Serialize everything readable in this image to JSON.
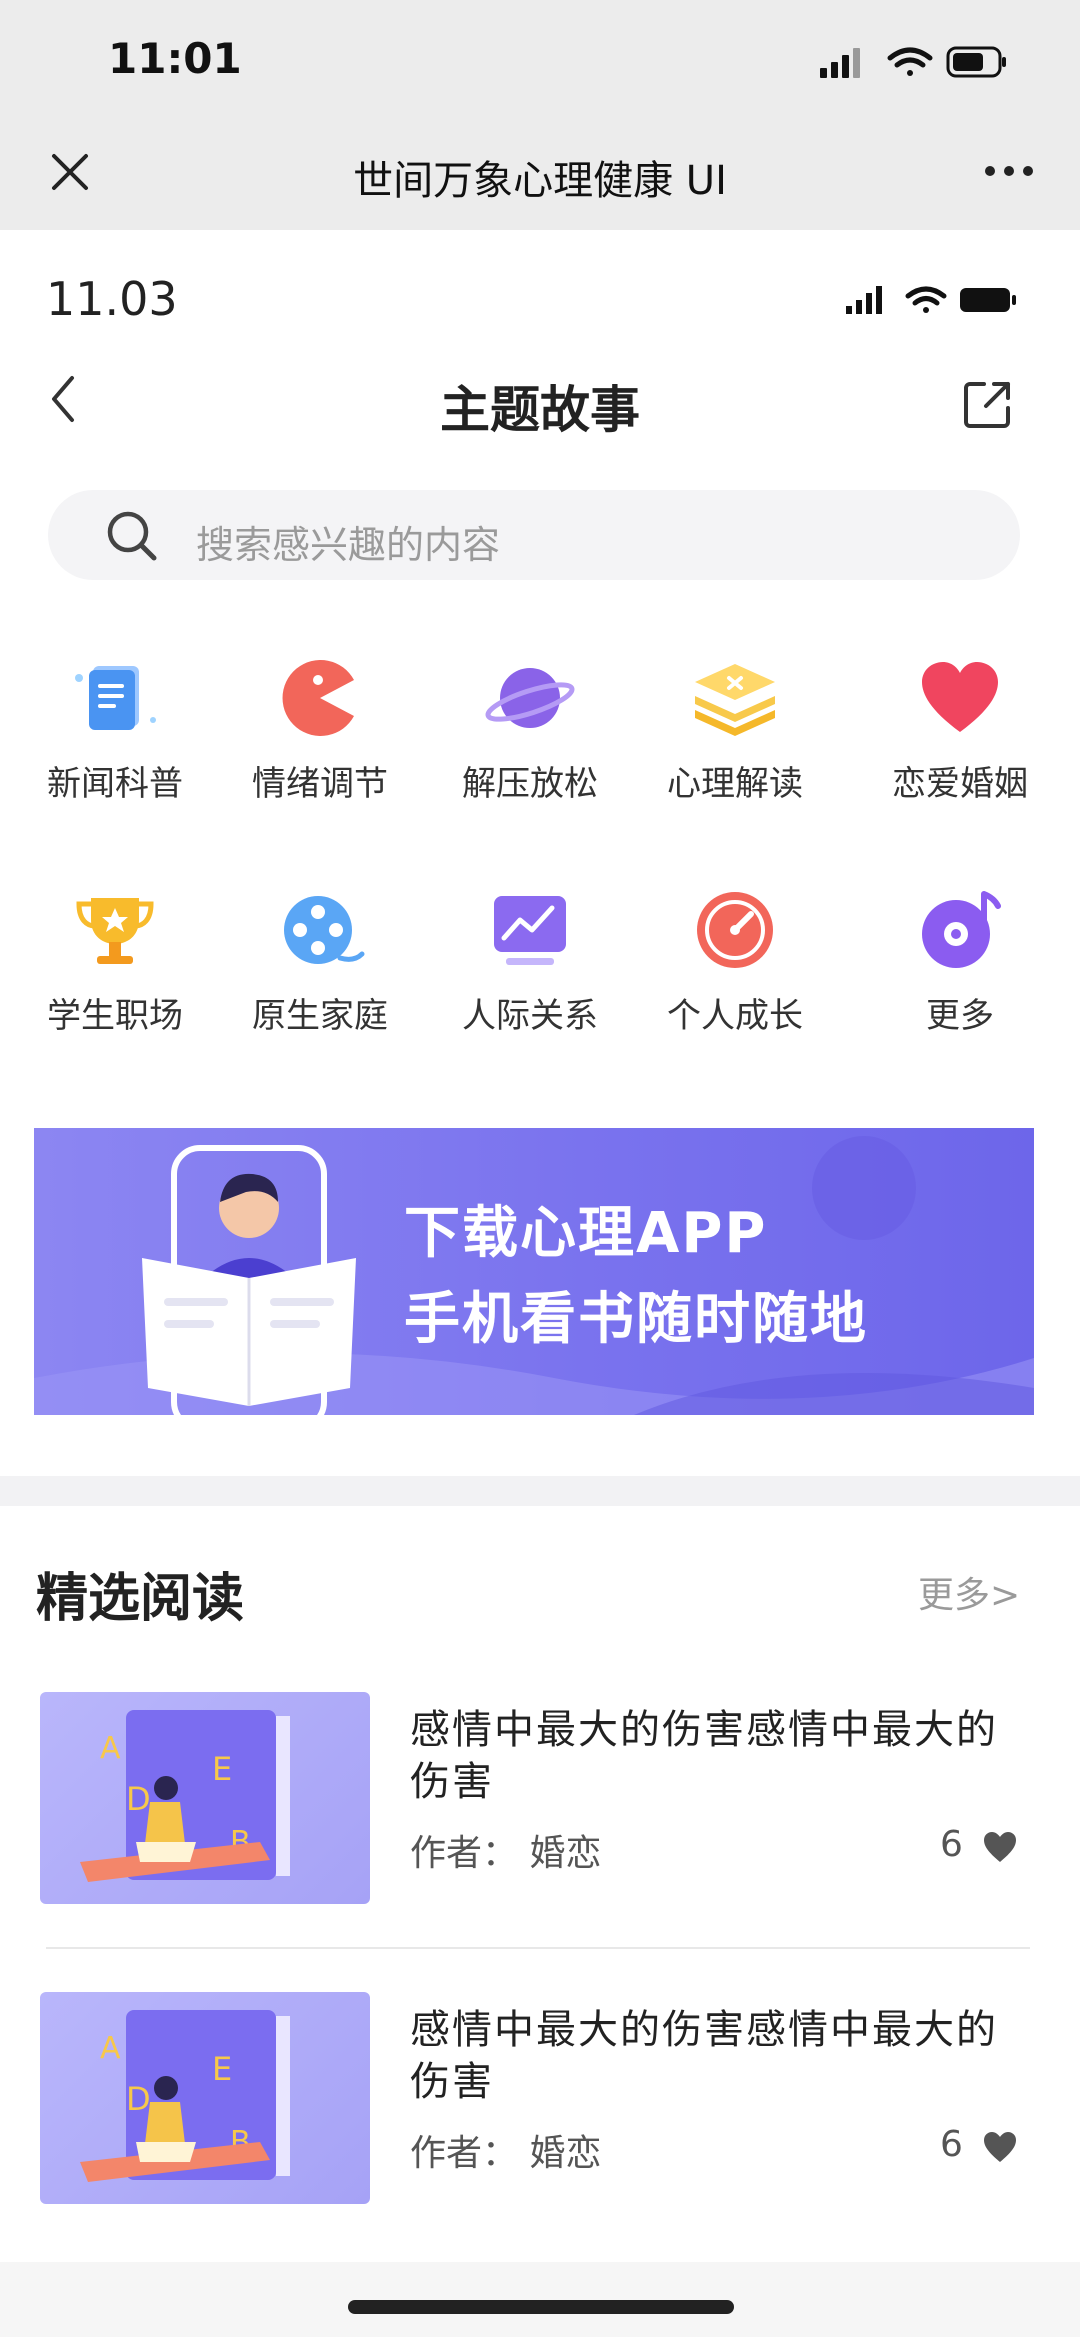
{
  "outer": {
    "time": "11:01",
    "title": "世间万象心理健康 UI"
  },
  "inner": {
    "time": "11.03",
    "page_title": "主题故事"
  },
  "search": {
    "placeholder": "搜索感兴趣的内容"
  },
  "categories": [
    {
      "label": "新闻科普",
      "icon": "news-icon"
    },
    {
      "label": "情绪调节",
      "icon": "pacman-icon"
    },
    {
      "label": "解压放松",
      "icon": "planet-icon"
    },
    {
      "label": "心理解读",
      "icon": "stack-icon"
    },
    {
      "label": "恋爱婚姻",
      "icon": "heart-icon"
    },
    {
      "label": "学生职场",
      "icon": "trophy-icon"
    },
    {
      "label": "原生家庭",
      "icon": "film-reel-icon"
    },
    {
      "label": "人际关系",
      "icon": "chart-monitor-icon"
    },
    {
      "label": "个人成长",
      "icon": "gauge-icon"
    },
    {
      "label": "更多",
      "icon": "music-disc-icon"
    }
  ],
  "banner": {
    "line1": "下载心理APP",
    "line2": "手机看书随时随地"
  },
  "section": {
    "title": "精选阅读",
    "more": "更多>"
  },
  "articles": [
    {
      "title": "感情中最大的伤害感情中最大的伤害",
      "author": "作者： 婚恋",
      "likes": "6"
    },
    {
      "title": "感情中最大的伤害感情中最大的伤害",
      "author": "作者： 婚恋",
      "likes": "6"
    }
  ],
  "colors": {
    "accent": "#7a73ee",
    "heart": "#f0455f"
  }
}
